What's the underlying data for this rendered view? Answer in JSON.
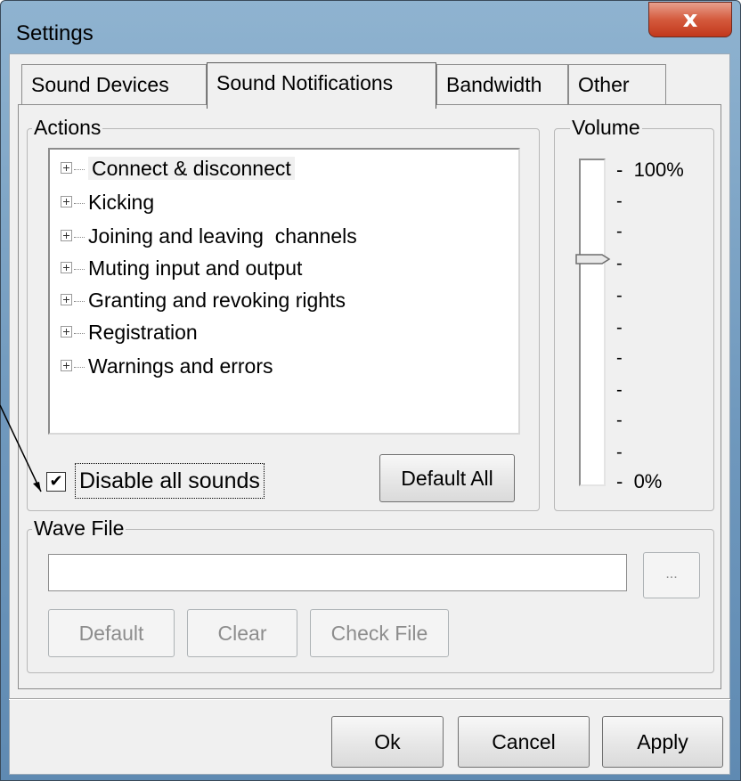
{
  "window": {
    "title": "Settings",
    "close_glyph": "x"
  },
  "tabs": [
    {
      "label": "Sound Devices",
      "active": false
    },
    {
      "label": "Sound Notifications",
      "active": true
    },
    {
      "label": "Bandwidth",
      "active": false
    },
    {
      "label": "Other",
      "active": false
    }
  ],
  "actions": {
    "label": "Actions",
    "items": [
      {
        "label": "Connect & disconnect",
        "selected": true
      },
      {
        "label": "Kicking"
      },
      {
        "label": "Joining and leaving  channels"
      },
      {
        "label": "Muting input and output"
      },
      {
        "label": "Granting and revoking rights"
      },
      {
        "label": "Registration"
      },
      {
        "label": "Warnings and errors"
      }
    ],
    "disable_all_sounds": {
      "label": "Disable all sounds",
      "checked": true,
      "mark": "✔"
    },
    "default_all_label": "Default All"
  },
  "volume": {
    "label": "Volume",
    "max_label": "100%",
    "min_label": "0%",
    "tick_mark": "-",
    "level_percent": 70
  },
  "wave_file": {
    "label": "Wave File",
    "value": "",
    "browse_label": "...",
    "default_label": "Default",
    "clear_label": "Clear",
    "check_file_label": "Check File"
  },
  "footer": {
    "ok_label": "Ok",
    "cancel_label": "Cancel",
    "apply_label": "Apply"
  },
  "icons": {
    "close": "close-icon",
    "expander": "plus-box-icon",
    "check": "checkmark-icon"
  },
  "colors": {
    "close_button": "#c2381c",
    "frame": "#6f98bd",
    "dialog_bg": "#f0f0f0"
  }
}
